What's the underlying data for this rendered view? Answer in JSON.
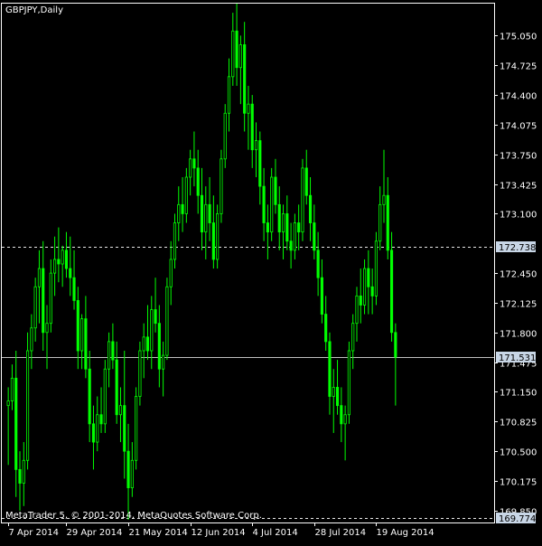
{
  "header": {
    "symbol_label": "GBPJPY,Daily"
  },
  "footer": {
    "copyright": "MetaTrader 5, © 2001-2014, MetaQuotes Software Corp."
  },
  "colors": {
    "background": "#000000",
    "frame": "#ffffff",
    "candle": "#00ff00",
    "tick_text": "#ffffff",
    "level_line": "#ffffff",
    "badge_bg": "#c8d6e6",
    "badge_text": "#000000"
  },
  "chart_data": {
    "type": "candlestick",
    "title": "GBPJPY,Daily",
    "y_ticks": [
      "175.050",
      "174.725",
      "174.400",
      "174.075",
      "173.750",
      "173.425",
      "173.100",
      "172.450",
      "172.125",
      "171.800",
      "171.475",
      "171.150",
      "170.825",
      "170.500",
      "170.175",
      "169.850"
    ],
    "ylim": [
      169.72,
      175.4
    ],
    "x_ticks": [
      {
        "label": "7 Apr 2014",
        "index": 0
      },
      {
        "label": "29 Apr 2014",
        "index": 15
      },
      {
        "label": "21 May 2014",
        "index": 31
      },
      {
        "label": "12 Jun 2014",
        "index": 47
      },
      {
        "label": "4 Jul 2014",
        "index": 63
      },
      {
        "label": "28 Jul 2014",
        "index": 79
      },
      {
        "label": "19 Aug 2014",
        "index": 95
      }
    ],
    "levels": [
      {
        "value": 172.738,
        "label": "172.738",
        "style": "dashed"
      },
      {
        "value": 171.531,
        "label": "171.531",
        "style": "solid"
      },
      {
        "value": 169.774,
        "label": "169.774",
        "style": "dashed"
      }
    ],
    "grid": false,
    "candles": [
      [
        171.0,
        171.2,
        170.35,
        171.05
      ],
      [
        171.05,
        171.45,
        170.95,
        171.3
      ],
      [
        171.3,
        171.6,
        170.0,
        170.3
      ],
      [
        170.3,
        170.5,
        169.85,
        170.15
      ],
      [
        170.15,
        170.6,
        169.9,
        170.4
      ],
      [
        170.4,
        171.8,
        170.3,
        171.6
      ],
      [
        171.6,
        172.0,
        171.4,
        171.85
      ],
      [
        171.85,
        172.4,
        171.7,
        172.3
      ],
      [
        172.3,
        172.7,
        171.9,
        172.5
      ],
      [
        172.5,
        172.8,
        171.6,
        171.8
      ],
      [
        171.8,
        172.1,
        171.4,
        171.9
      ],
      [
        171.9,
        172.6,
        171.8,
        172.45
      ],
      [
        172.45,
        172.85,
        172.2,
        172.6
      ],
      [
        172.6,
        172.95,
        172.35,
        172.55
      ],
      [
        172.55,
        172.75,
        172.3,
        172.7
      ],
      [
        172.7,
        172.9,
        172.4,
        172.5
      ],
      [
        172.5,
        172.85,
        172.2,
        172.4
      ],
      [
        172.4,
        172.7,
        172.05,
        172.15
      ],
      [
        172.15,
        172.3,
        171.4,
        171.6
      ],
      [
        171.6,
        172.0,
        171.4,
        171.95
      ],
      [
        171.95,
        172.2,
        171.3,
        171.4
      ],
      [
        171.4,
        171.6,
        170.6,
        170.8
      ],
      [
        170.8,
        171.0,
        170.3,
        170.6
      ],
      [
        170.6,
        171.1,
        170.5,
        170.9
      ],
      [
        170.9,
        171.2,
        170.7,
        170.8
      ],
      [
        170.8,
        171.5,
        170.7,
        171.4
      ],
      [
        171.4,
        171.8,
        171.2,
        171.7
      ],
      [
        171.7,
        171.9,
        171.4,
        171.5
      ],
      [
        171.5,
        171.7,
        170.8,
        170.9
      ],
      [
        170.9,
        171.2,
        170.6,
        171.0
      ],
      [
        171.0,
        171.6,
        170.2,
        170.5
      ],
      [
        170.5,
        170.8,
        169.75,
        170.1
      ],
      [
        170.1,
        170.6,
        170.0,
        170.4
      ],
      [
        170.4,
        171.2,
        170.3,
        171.1
      ],
      [
        171.1,
        171.7,
        171.0,
        171.6
      ],
      [
        171.6,
        171.9,
        171.3,
        171.75
      ],
      [
        171.75,
        172.1,
        171.5,
        171.6
      ],
      [
        171.6,
        172.2,
        171.4,
        172.05
      ],
      [
        172.05,
        172.4,
        171.8,
        171.9
      ],
      [
        171.9,
        172.1,
        171.2,
        171.4
      ],
      [
        171.4,
        171.7,
        171.1,
        171.55
      ],
      [
        171.55,
        172.4,
        171.5,
        172.3
      ],
      [
        172.3,
        172.8,
        172.1,
        172.6
      ],
      [
        172.6,
        173.1,
        172.5,
        173.0
      ],
      [
        173.0,
        173.4,
        172.8,
        173.2
      ],
      [
        173.2,
        173.5,
        172.9,
        173.1
      ],
      [
        173.1,
        173.6,
        173.0,
        173.5
      ],
      [
        173.5,
        173.8,
        173.3,
        173.7
      ],
      [
        173.7,
        174.0,
        173.4,
        173.6
      ],
      [
        173.6,
        173.8,
        173.1,
        173.3
      ],
      [
        173.3,
        173.6,
        172.7,
        172.9
      ],
      [
        172.9,
        173.4,
        172.6,
        173.2
      ],
      [
        173.2,
        173.5,
        172.8,
        173.0
      ],
      [
        173.0,
        173.3,
        172.5,
        172.6
      ],
      [
        172.6,
        173.2,
        172.5,
        173.1
      ],
      [
        173.1,
        173.8,
        173.0,
        173.7
      ],
      [
        173.7,
        174.3,
        173.6,
        174.2
      ],
      [
        174.2,
        174.8,
        174.0,
        174.6
      ],
      [
        174.6,
        175.3,
        174.5,
        175.1
      ],
      [
        175.1,
        175.4,
        174.5,
        174.7
      ],
      [
        174.7,
        175.05,
        174.3,
        174.95
      ],
      [
        174.95,
        175.2,
        174.0,
        174.2
      ],
      [
        174.2,
        174.5,
        173.8,
        174.3
      ],
      [
        174.3,
        174.4,
        173.6,
        173.8
      ],
      [
        173.8,
        174.1,
        173.5,
        173.9
      ],
      [
        173.9,
        174.0,
        173.2,
        173.4
      ],
      [
        173.4,
        173.6,
        172.8,
        173.0
      ],
      [
        173.0,
        173.2,
        172.6,
        172.9
      ],
      [
        172.9,
        173.6,
        172.8,
        173.5
      ],
      [
        173.5,
        173.7,
        173.1,
        173.2
      ],
      [
        173.2,
        173.4,
        172.7,
        172.9
      ],
      [
        172.9,
        173.2,
        172.6,
        173.1
      ],
      [
        173.1,
        173.3,
        172.7,
        172.8
      ],
      [
        172.8,
        173.0,
        172.5,
        172.7
      ],
      [
        172.7,
        173.1,
        172.6,
        173.0
      ],
      [
        173.0,
        173.2,
        172.7,
        172.9
      ],
      [
        172.9,
        173.7,
        172.8,
        173.6
      ],
      [
        173.6,
        173.8,
        173.2,
        173.3
      ],
      [
        173.3,
        173.5,
        172.8,
        173.0
      ],
      [
        173.0,
        173.2,
        172.6,
        172.7
      ],
      [
        172.7,
        172.9,
        172.2,
        172.4
      ],
      [
        172.4,
        172.6,
        171.9,
        172.0
      ],
      [
        172.0,
        172.2,
        171.6,
        171.7
      ],
      [
        171.7,
        171.8,
        170.9,
        171.1
      ],
      [
        171.1,
        171.4,
        170.7,
        171.2
      ],
      [
        171.2,
        171.5,
        170.9,
        171.0
      ],
      [
        171.0,
        171.2,
        170.6,
        170.8
      ],
      [
        170.8,
        171.0,
        170.4,
        170.9
      ],
      [
        170.9,
        171.7,
        170.8,
        171.6
      ],
      [
        171.6,
        172.0,
        171.4,
        171.9
      ],
      [
        171.9,
        172.3,
        171.7,
        172.2
      ],
      [
        172.2,
        172.5,
        171.9,
        172.1
      ],
      [
        172.1,
        172.6,
        172.0,
        172.5
      ],
      [
        172.5,
        172.7,
        172.0,
        172.3
      ],
      [
        172.3,
        172.5,
        172.0,
        172.2
      ],
      [
        172.2,
        172.9,
        172.1,
        172.8
      ],
      [
        172.8,
        173.4,
        172.7,
        173.2
      ],
      [
        173.2,
        173.8,
        173.0,
        173.3
      ],
      [
        173.3,
        173.5,
        172.6,
        172.7
      ],
      [
        172.7,
        172.9,
        171.7,
        171.8
      ],
      [
        171.8,
        171.9,
        171.0,
        171.53
      ]
    ]
  }
}
